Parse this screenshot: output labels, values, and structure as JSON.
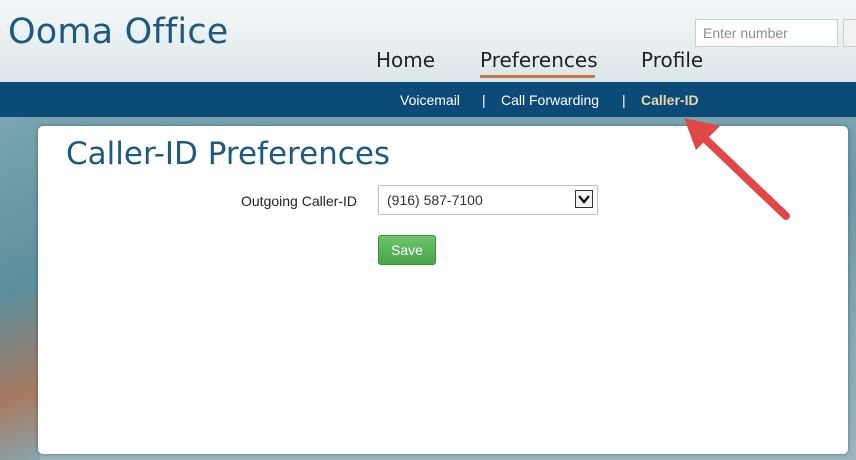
{
  "app": {
    "title": "Ooma Office"
  },
  "search": {
    "placeholder": "Enter number"
  },
  "main_nav": {
    "items": [
      {
        "label": "Home"
      },
      {
        "label": "Preferences"
      },
      {
        "label": "Profile"
      }
    ],
    "active": "Preferences"
  },
  "sub_nav": {
    "items": [
      {
        "label": "Voicemail"
      },
      {
        "label": "Call Forwarding"
      },
      {
        "label": "Caller-ID"
      }
    ],
    "separator": "|",
    "active": "Caller-ID"
  },
  "page": {
    "title": "Caller-ID Preferences",
    "outgoing_label": "Outgoing Caller-ID",
    "outgoing_value": "(916) 587-7100",
    "save_label": "Save"
  },
  "colors": {
    "brand_blue": "#1e5a80",
    "subnav_bg": "#0c4a78",
    "active_subnav_text": "#e8d9a8",
    "nav_underline": "#c8734a",
    "save_green": "#48a448",
    "annotation_arrow": "#e04848"
  },
  "icons": {
    "select_arrow": "chevron-down-icon",
    "annotation": "red-arrow-icon"
  }
}
